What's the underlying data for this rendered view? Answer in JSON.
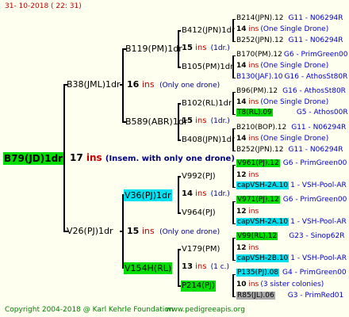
{
  "header": {
    "date": "31-  10-2018  (  22:  31)"
  },
  "root": {
    "name": "B79(JD)1dr",
    "num": "17",
    "unit": "ins",
    "note": "(Insem. with only one drone)"
  },
  "gen1": [
    {
      "name": "B38(JML)1dr",
      "num": "16",
      "unit": "ins",
      "note": "(Only one drone)"
    },
    {
      "name": "V26(PJ)1dr",
      "num": "15",
      "unit": "ins",
      "note": "(Only one drone)"
    }
  ],
  "gen2": [
    {
      "name": "B119(PM)1dr",
      "num": "15",
      "unit": "ins",
      "note": "(1dr.)"
    },
    {
      "name": "B589(ABR)1dr",
      "num": "15",
      "unit": "ins",
      "note": "(1dr.)"
    },
    {
      "name": "V36(PJ)1dr",
      "num": "14",
      "unit": "ins",
      "note": "(1dr.)"
    },
    {
      "name": "V154H(RL)",
      "num": "13",
      "unit": "ins",
      "note": "(1 c.)"
    }
  ],
  "gen3": [
    {
      "name": "B412(JPN)1dr"
    },
    {
      "name": "B105(PM)1dr"
    },
    {
      "name": "B102(RL)1dr"
    },
    {
      "name": "B408(JPN)1dr"
    },
    {
      "name": "V992(PJ)"
    },
    {
      "name": "V964(PJ)"
    },
    {
      "name": "V179(PM)"
    },
    {
      "name": "P214(PJ)"
    }
  ],
  "gen4": [
    {
      "top": "B214(JPN).12",
      "top_tag": "G11 - N06294R",
      "num": "14",
      "unit": "ins",
      "note": "(One Single Drone)",
      "bot": "B252(JPN).12",
      "bot_tag": "G11 - N06294R"
    },
    {
      "top": "B170(PM).12",
      "top_tag": "G6 - PrimGreen00",
      "num": "14",
      "unit": "ins",
      "note": "(One Single Drone)",
      "bot": "B130(JAF).10",
      "bot_tag": "G16 - AthosSt80R"
    },
    {
      "top": "B96(PM).12",
      "top_tag": "G16 - AthosSt80R",
      "num": "14",
      "unit": "ins",
      "note": "(One Single Drone)",
      "bot": "T8(RL).09",
      "bot_tag": "G5 - Athos00R"
    },
    {
      "top": "B210(BOP).12",
      "top_tag": "G11 - N06294R",
      "num": "14",
      "unit": "ins",
      "note": "(One Single Drone)",
      "bot": "B252(JPN).12",
      "bot_tag": "G11 - N06294R"
    },
    {
      "top": "V961(PJ).12",
      "top_tag": "G6 - PrimGreen00",
      "num": "12",
      "unit": "ins",
      "note": "",
      "bot": "capVSH-2A.10",
      "bot_tag": "1 - VSH-Pool-AR"
    },
    {
      "top": "V971(PJ).12",
      "top_tag": "G6 - PrimGreen00",
      "num": "12",
      "unit": "ins",
      "note": "",
      "bot": "capVSH-2A.10",
      "bot_tag": "1 - VSH-Pool-AR"
    },
    {
      "top": "V99(RL).12",
      "top_tag": "G23 - Sinop62R",
      "num": "12",
      "unit": "ins",
      "note": "",
      "bot": "capVSH-2B.10",
      "bot_tag": "1 - VSH-Pool-AR"
    },
    {
      "top": "P135(PJ).08",
      "top_tag": "G4 - PrimGreen00",
      "num": "10",
      "unit": "ins",
      "note": "(3 sister colonies)",
      "bot": "R85(JL).06",
      "bot_tag": "G3 - PrimRed01"
    }
  ],
  "footer": {
    "copyright": "Copyright 2004-2018 @ Karl Kehrle Foundation",
    "site": "www.pedigreeapis.org"
  },
  "colors": {
    "background": "#fffff0",
    "green_box": "#00dd00",
    "cyan_box": "#00e0f0",
    "gray_box": "#a8a8a8",
    "red": "#c00000",
    "blue": "#0000c8"
  }
}
